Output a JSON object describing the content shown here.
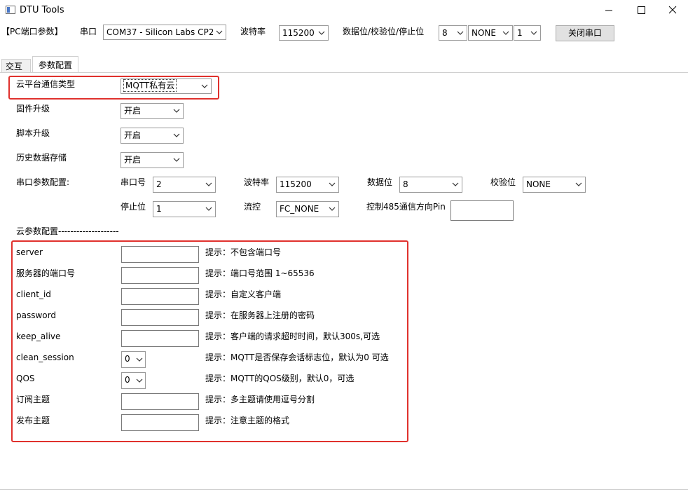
{
  "window": {
    "title": "DTU Tools",
    "controls": {
      "minimize": "—",
      "maximize": "☐",
      "close": "✕"
    }
  },
  "toolbar": {
    "section_label": "【PC端口参数】",
    "port_label": "串口",
    "port_value": "COM37 - Silicon Labs CP2",
    "baud_label": "波特率",
    "baud_value": "115200",
    "frame_label": "数据位/校验位/停止位",
    "databits_value": "8",
    "parity_value": "NONE",
    "stopbits_value": "1",
    "close_port_label": "关闭串口"
  },
  "tabs": [
    {
      "label": "交互",
      "active": false
    },
    {
      "label": "参数配置",
      "active": true
    }
  ],
  "settings": {
    "cloud_type": {
      "label": "云平台通信类型",
      "value": "MQTT私有云"
    },
    "firmware_upgrade": {
      "label": "固件升级",
      "value": "开启"
    },
    "script_upgrade": {
      "label": "脚本升级",
      "value": "开启"
    },
    "history_storage": {
      "label": "历史数据存储",
      "value": "开启"
    }
  },
  "serial_config": {
    "section_label": "串口参数配置:",
    "port_no_label": "串口号",
    "port_no_value": "2",
    "baud_label": "波特率",
    "baud_value": "115200",
    "databits_label": "数据位",
    "databits_value": "8",
    "parity_label": "校验位",
    "parity_value": "NONE",
    "stopbits_label": "停止位",
    "stopbits_value": "1",
    "flow_label": "流控",
    "flow_value": "FC_NONE",
    "rs485_pin_label": "控制485通信方向Pin",
    "rs485_pin_value": ""
  },
  "cloud_params": {
    "section_label": "云参数配置--------------------",
    "server": {
      "label": "server",
      "value": "",
      "hint": "提示：不包含端口号"
    },
    "server_port": {
      "label": "服务器的端口号",
      "value": "",
      "hint": "提示：端口号范围 1~65536"
    },
    "client_id": {
      "label": "client_id",
      "value": "",
      "hint": "提示：自定义客户端"
    },
    "password": {
      "label": "password",
      "value": "",
      "hint": "提示：在服务器上注册的密码"
    },
    "keep_alive": {
      "label": "keep_alive",
      "value": "",
      "hint": "提示：客户端的请求超时时间，默认300s,可选"
    },
    "clean_session": {
      "label": "clean_session",
      "value": "0",
      "hint": "提示：MQTT是否保存会话标志位，默认为0 可选"
    },
    "qos": {
      "label": "QOS",
      "value": "0",
      "hint": "提示：MQTT的QOS级别，默认0，可选"
    },
    "subscribe_topic": {
      "label": "订阅主题",
      "value": "",
      "hint": "提示：多主题请使用逗号分割"
    },
    "publish_topic": {
      "label": "发布主题",
      "value": "",
      "hint": "提示：注意主题的格式"
    }
  },
  "colors": {
    "highlight": "#e0312d",
    "tab_bg": "#ffffff",
    "window_bg": "#ffffff",
    "button_bg": "#e1e1e1"
  },
  "icons": {
    "app": "app-window-icon",
    "chevron": "chevron-down-icon"
  }
}
